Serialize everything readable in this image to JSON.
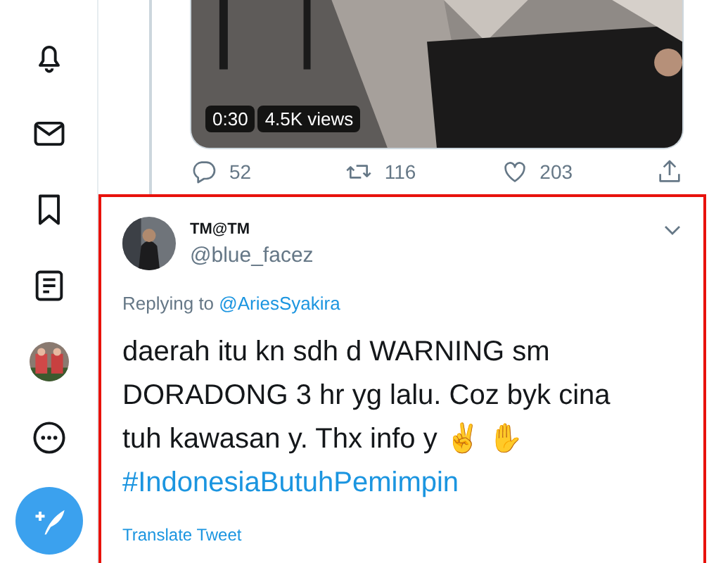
{
  "sidebar": {
    "items": [
      {
        "kind": "notifications"
      },
      {
        "kind": "messages"
      },
      {
        "kind": "bookmarks"
      },
      {
        "kind": "lists"
      },
      {
        "kind": "avatar"
      },
      {
        "kind": "more"
      }
    ],
    "compose": {
      "kind": "compose"
    }
  },
  "previous_tweet": {
    "video": {
      "kind": "picture",
      "duration": "0:30",
      "views": "4.5K views"
    },
    "actions": [
      {
        "kind": "reply",
        "count": "52"
      },
      {
        "kind": "retweet",
        "count": "116"
      },
      {
        "kind": "like",
        "count": "203"
      },
      {
        "kind": "share"
      }
    ]
  },
  "reply_tweet": {
    "highlighted": true,
    "name": "TM@TM",
    "handle": "@blue_facez",
    "replying_label": "Replying to",
    "replying_handle": "@AriesSyakira",
    "text": "daerah itu kn sdh d WARNING sm DORADONG 3 hr yg lalu. Coz byk cina tuh kawasan y. Thx info y ✌️ ✋",
    "hashtag": "#IndonesiaButuhPemimpin",
    "translate": "Translate Tweet"
  }
}
